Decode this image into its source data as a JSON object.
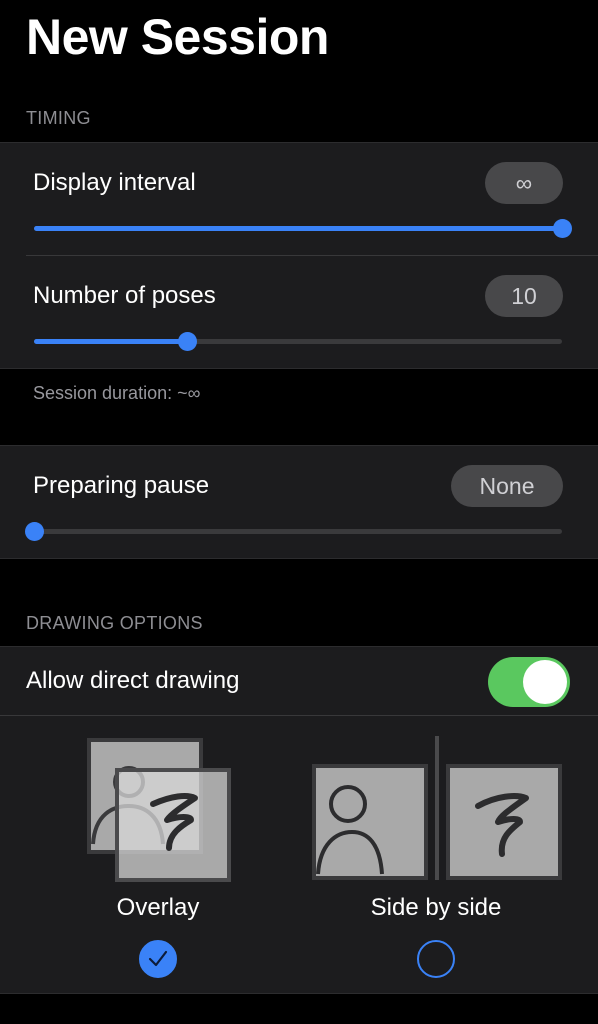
{
  "page": {
    "title": "New Session"
  },
  "timing": {
    "header": "TIMING",
    "display_interval": {
      "label": "Display interval",
      "value": "∞",
      "slider_fraction": 1.0
    },
    "number_of_poses": {
      "label": "Number of poses",
      "value": "10",
      "slider_fraction": 0.29
    },
    "session_duration": "Session duration: ~∞"
  },
  "pause": {
    "preparing_pause": {
      "label": "Preparing pause",
      "value": "None",
      "slider_fraction": 0.0
    }
  },
  "drawing": {
    "header": "DRAWING OPTIONS",
    "allow_direct_drawing": {
      "label": "Allow direct drawing",
      "enabled": true
    },
    "modes": [
      {
        "label": "Overlay",
        "selected": true,
        "icon": "overlay-icon"
      },
      {
        "label": "Side by side",
        "selected": false,
        "icon": "side-by-side-icon"
      }
    ]
  },
  "colors": {
    "accent": "#3a82f7",
    "toggle_on": "#5ac85f",
    "group_bg": "#1c1c1e",
    "page_bg": "#000000"
  }
}
